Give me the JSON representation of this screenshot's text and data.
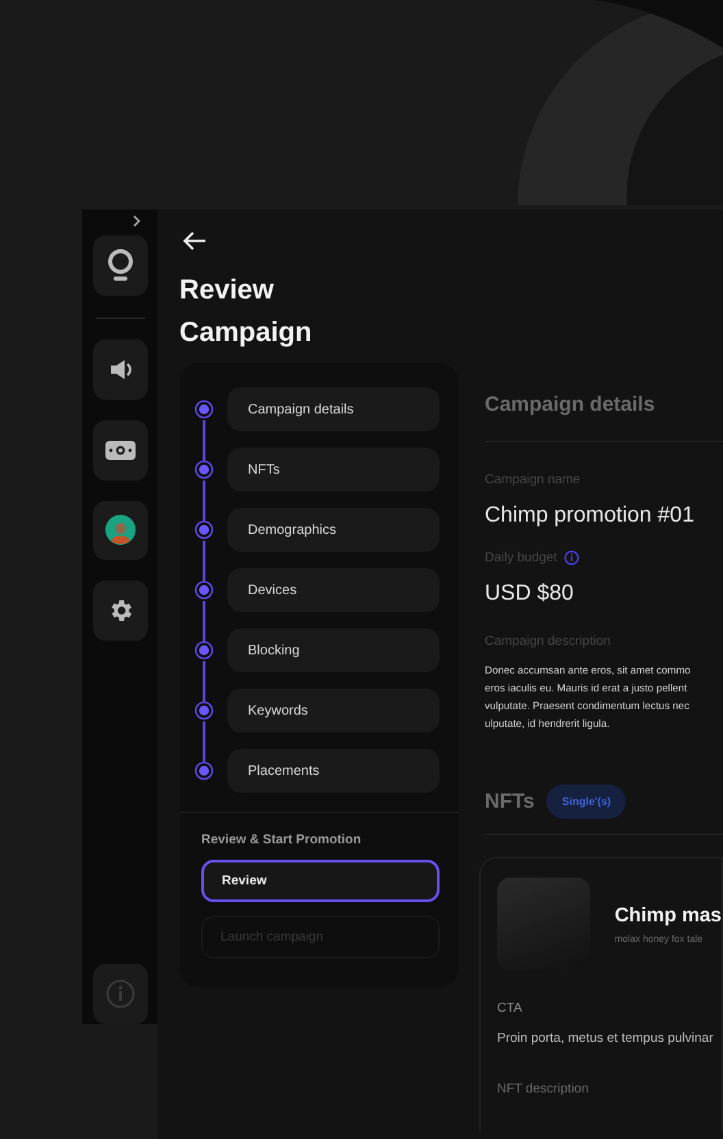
{
  "sidebar": {
    "items": [
      {
        "kind": "logo",
        "selected": false
      },
      {
        "kind": "speaker",
        "selected": false
      },
      {
        "kind": "money",
        "selected": false
      },
      {
        "kind": "avatar",
        "selected": false
      },
      {
        "kind": "settings",
        "selected": false
      }
    ],
    "footer": {
      "kind": "info"
    }
  },
  "header": {
    "title": "Review Campaign"
  },
  "steps": [
    {
      "label": "Campaign details",
      "done": true
    },
    {
      "label": "NFTs",
      "done": true
    },
    {
      "label": "Demographics",
      "done": true
    },
    {
      "label": "Devices",
      "done": true
    },
    {
      "label": "Blocking",
      "done": true
    },
    {
      "label": "Keywords",
      "done": true
    },
    {
      "label": "Placements",
      "done": true
    }
  ],
  "promotion": {
    "title": "Review & Start Promotion",
    "buttons": [
      {
        "label": "Review",
        "selected": true,
        "disabled": false
      },
      {
        "label": "Launch campaign",
        "selected": false,
        "disabled": true
      }
    ]
  },
  "details": {
    "title": "Campaign details",
    "fields": [
      {
        "label": "Campaign name",
        "value": "Chimp promotion #01",
        "info": false
      },
      {
        "label": "Daily budget",
        "value": "USD $80",
        "info": true
      }
    ],
    "description": {
      "label": "Campaign description",
      "lines": [
        "Donec accumsan ante eros, sit amet commo",
        "eros iaculis eu. Mauris id erat a justo pellent",
        "vulputate. Praesent condimentum lectus nec",
        "ulputate, id hendrerit ligula."
      ]
    }
  },
  "nfts": {
    "title": "NFTs",
    "badge": "Single'(s)",
    "card": {
      "name": "Chimp mas",
      "subtitle": "molax honey fox tale",
      "cta_label": "CTA",
      "cta_text": "Proin porta, metus et tempus pulvinar",
      "description_label": "NFT description"
    }
  }
}
